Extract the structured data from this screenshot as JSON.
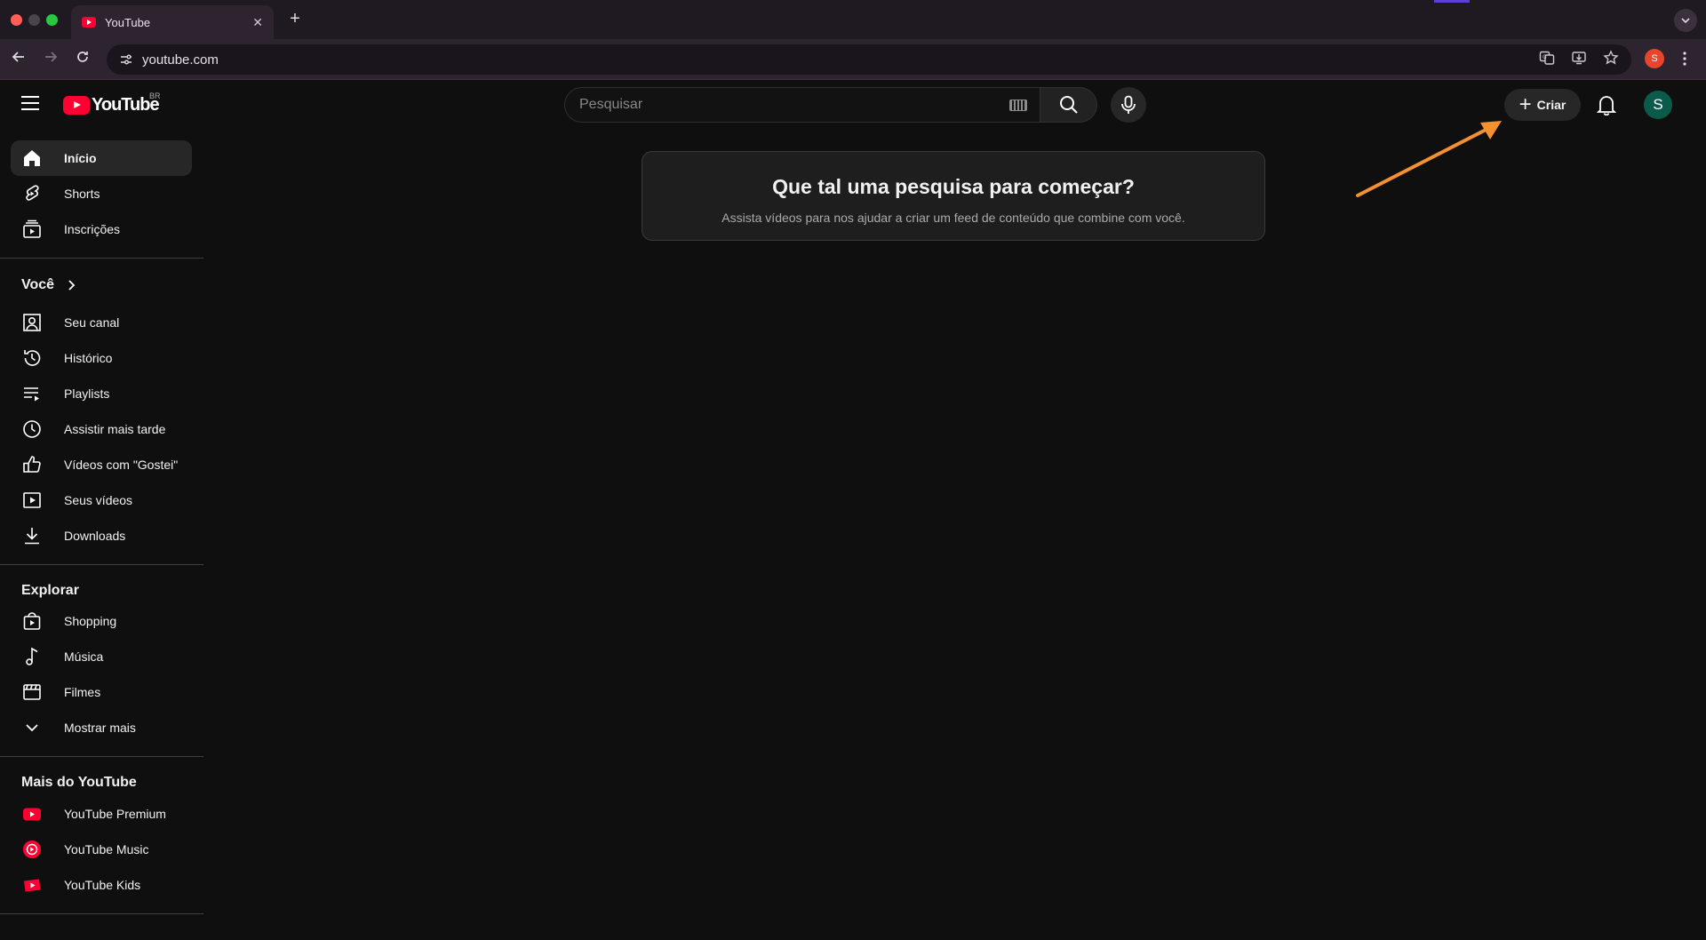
{
  "browser": {
    "tab_title": "YouTube",
    "tab_close": "✕",
    "new_tab": "+",
    "url": "youtube.com",
    "profile_initial": "S",
    "icons": [
      "back-icon",
      "forward-icon",
      "reload-icon",
      "site-settings-icon",
      "translate-icon",
      "install-icon",
      "bookmark-star-icon",
      "menu-icon"
    ]
  },
  "header": {
    "logo_text": "YouTube",
    "country_code": "BR",
    "search_placeholder": "Pesquisar",
    "create_label": "Criar",
    "avatar_initial": "S"
  },
  "sidebar": {
    "main": [
      {
        "label": "Início",
        "icon": "home-icon",
        "active": true
      },
      {
        "label": "Shorts",
        "icon": "shorts-icon"
      },
      {
        "label": "Inscrições",
        "icon": "subscriptions-icon"
      }
    ],
    "you_title": "Você",
    "you": [
      {
        "label": "Seu canal",
        "icon": "channel-icon"
      },
      {
        "label": "Histórico",
        "icon": "history-icon"
      },
      {
        "label": "Playlists",
        "icon": "playlists-icon"
      },
      {
        "label": "Assistir mais tarde",
        "icon": "watch-later-icon"
      },
      {
        "label": "Vídeos com \"Gostei\"",
        "icon": "liked-icon"
      },
      {
        "label": "Seus vídeos",
        "icon": "your-videos-icon"
      },
      {
        "label": "Downloads",
        "icon": "download-icon"
      }
    ],
    "explore_title": "Explorar",
    "explore": [
      {
        "label": "Shopping",
        "icon": "shopping-icon"
      },
      {
        "label": "Música",
        "icon": "music-icon"
      },
      {
        "label": "Filmes",
        "icon": "movies-icon"
      },
      {
        "label": "Mostrar mais",
        "icon": "chevron-down-icon"
      }
    ],
    "more_title": "Mais do YouTube",
    "more": [
      {
        "label": "YouTube Premium",
        "icon": "youtube-premium-icon"
      },
      {
        "label": "YouTube Music",
        "icon": "youtube-music-icon"
      },
      {
        "label": "YouTube Kids",
        "icon": "youtube-kids-icon"
      }
    ]
  },
  "main": {
    "prompt_title": "Que tal uma pesquisa para começar?",
    "prompt_subtitle": "Assista vídeos para nos ajudar a criar um feed de conteúdo que combine com você."
  },
  "colors": {
    "background": "#0f0f0f",
    "brand_red": "#ff0033",
    "annotation_arrow": "#f5902f"
  }
}
